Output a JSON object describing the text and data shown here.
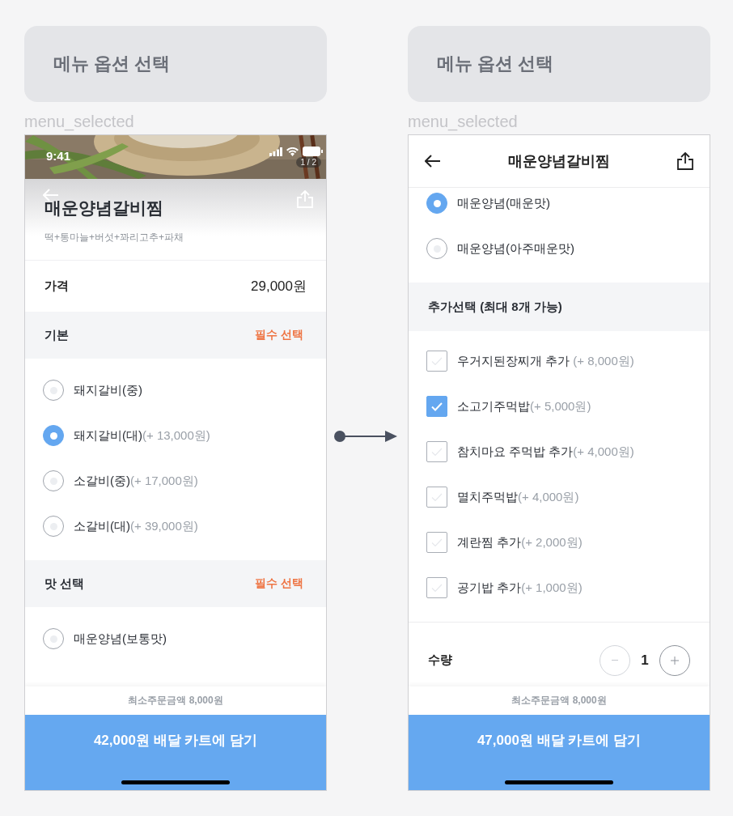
{
  "screens": [
    {
      "kind": "detail",
      "header_title": "메뉴 옵션 선택",
      "frame_label": "menu_selected",
      "status_bar": {
        "time": "9:41"
      },
      "photo": {
        "kind": "picture",
        "page_counter": "1 / 2"
      },
      "menu": {
        "name": "매운양념갈비찜",
        "description": "떡+통마늘+버섯+꽈리고추+파채"
      },
      "price": {
        "label": "가격",
        "value": "29,000원"
      },
      "sections": [
        {
          "kind": "radio",
          "title": "기본",
          "badge": "필수 선택",
          "options": [
            {
              "label": "돼지갈비(중)",
              "selected": false
            },
            {
              "label": "돼지갈비(대)",
              "price": "(+ 13,000원)",
              "selected": true
            },
            {
              "label": "소갈비(중)",
              "price": "(+ 17,000원)",
              "selected": false
            },
            {
              "label": "소갈비(대)",
              "price": "(+ 39,000원)",
              "selected": false
            }
          ]
        },
        {
          "kind": "radio",
          "title": "맛 선택",
          "badge": "필수 선택",
          "options": [
            {
              "label": "매운양념(보통맛)",
              "selected": false
            }
          ]
        }
      ],
      "min_order": "최소주문금액 8,000원",
      "cart_button": "42,000원 배달 카트에 담기"
    },
    {
      "kind": "scrolled",
      "header_title": "메뉴 옵션 선택",
      "frame_label": "menu_selected",
      "nav_title": "매운양념갈비찜",
      "sections": [
        {
          "kind": "radio",
          "options": [
            {
              "label": "매운양념(매운맛)",
              "selected": true
            },
            {
              "label": "매운양념(아주매운맛)",
              "selected": false
            }
          ]
        },
        {
          "kind": "checkbox",
          "title": "추가선택 (최대 8개 가능)",
          "options": [
            {
              "label": "우거지된장찌개 추가",
              "price": " (+ 8,000원)",
              "checked": false
            },
            {
              "label": "소고기주먹밥",
              "price": "(+ 5,000원)",
              "checked": true
            },
            {
              "label": "참치마요 주먹밥 추가",
              "price": "(+ 4,000원)",
              "checked": false
            },
            {
              "label": "멸치주먹밥",
              "price": "(+ 4,000원)",
              "checked": false
            },
            {
              "label": "계란찜 추가",
              "price": "(+ 2,000원)",
              "checked": false
            },
            {
              "label": "공기밥 추가",
              "price": "(+ 1,000원)",
              "checked": false
            }
          ]
        }
      ],
      "quantity": {
        "label": "수량",
        "value": "1"
      },
      "min_order": "최소주문금액 8,000원",
      "cart_button": "47,000원 배달 카트에 담기"
    }
  ]
}
